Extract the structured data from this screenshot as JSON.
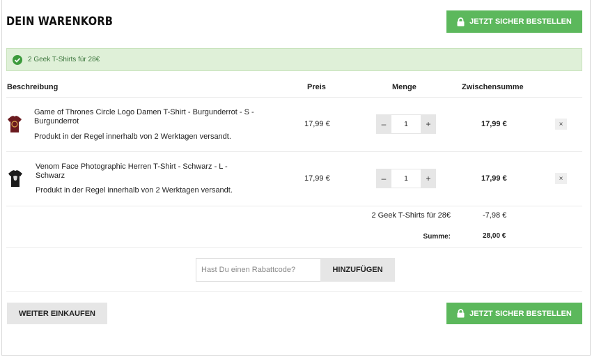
{
  "page_title": "DEIN WARENKORB",
  "order_button_label": "JETZT SICHER BESTELLEN",
  "notice_text": "2 Geek T-Shirts für 28€",
  "columns": {
    "description": "Beschreibung",
    "price": "Preis",
    "quantity": "Menge",
    "subtotal": "Zwischensumme"
  },
  "items": [
    {
      "name": "Game of Thrones Circle Logo Damen T-Shirt - Burgunderrot - S - Burgunderrot",
      "shipping": "Produkt in der Regel innerhalb von 2 Werktagen versandt.",
      "price": "17,99 €",
      "quantity": "1",
      "subtotal": "17,99 €",
      "thumb_color": "#6b1a1f"
    },
    {
      "name": "Venom Face Photographic Herren T-Shirt - Schwarz - L - Schwarz",
      "shipping": "Produkt in der Regel innerhalb von 2 Werktagen versandt.",
      "price": "17,99 €",
      "quantity": "1",
      "subtotal": "17,99 €",
      "thumb_color": "#1b1b1b"
    }
  ],
  "qty_minus": "–",
  "qty_plus": "+",
  "remove_symbol": "×",
  "discount": {
    "label": "2 Geek T-Shirts für 28€",
    "value": "-7,98 €"
  },
  "total": {
    "label": "Summe:",
    "value": "28,00 €"
  },
  "coupon": {
    "placeholder": "Hast Du einen Rabattcode?",
    "button_label": "HINZUFÜGEN"
  },
  "continue_label": "WEITER EINKAUFEN",
  "colors": {
    "accent_green": "#5cb85c",
    "notice_bg": "#dff0d8",
    "notice_text": "#3c763d",
    "button_grey": "#e6e6e6"
  }
}
